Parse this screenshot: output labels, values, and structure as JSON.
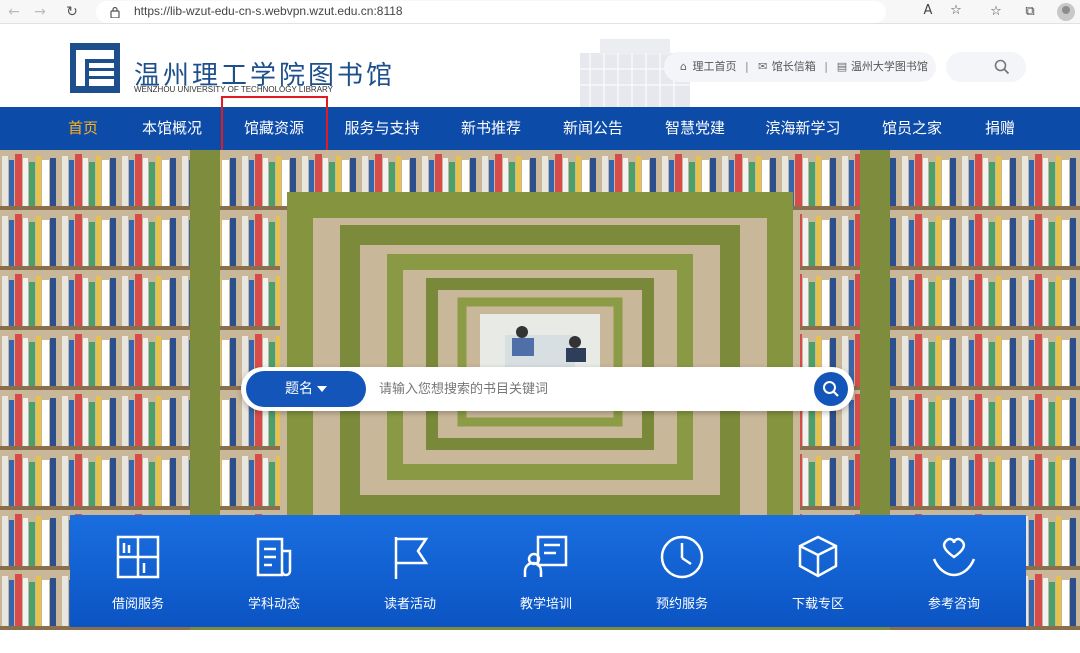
{
  "browser": {
    "url": "https://lib-wzut-edu-cn-s.webvpn.wzut.edu.cn:8118",
    "back_icon": "arrow-left-icon",
    "forward_icon": "arrow-right-icon",
    "reload_icon": "reload-icon"
  },
  "site": {
    "name_cn": "温州理工学院图书馆",
    "name_en": "WENZHOU UNIVERSITY OF TECHNOLOGY LIBRARY",
    "brand_color": "#0d4ba8",
    "active_color": "#ffb21a"
  },
  "quick_links": [
    {
      "label": "理工首页",
      "icon": "home-icon"
    },
    {
      "label": "馆长信箱",
      "icon": "mail-icon"
    },
    {
      "label": "温州大学图书馆",
      "icon": "library-icon"
    }
  ],
  "nav": [
    {
      "label": "首页",
      "active": true
    },
    {
      "label": "本馆概况"
    },
    {
      "label": "馆藏资源",
      "highlighted": true
    },
    {
      "label": "服务与支持"
    },
    {
      "label": "新书推荐"
    },
    {
      "label": "新闻公告"
    },
    {
      "label": "智慧党建"
    },
    {
      "label": "滨海新学习"
    },
    {
      "label": "馆员之家"
    },
    {
      "label": "捐赠"
    }
  ],
  "search": {
    "type_label": "题名",
    "placeholder": "请输入您想搜索的书目关键词"
  },
  "services": [
    {
      "label": "借阅服务",
      "icon": "bookshelf-icon"
    },
    {
      "label": "学科动态",
      "icon": "document-icon"
    },
    {
      "label": "读者活动",
      "icon": "flag-icon"
    },
    {
      "label": "教学培训",
      "icon": "training-icon"
    },
    {
      "label": "预约服务",
      "icon": "clock-icon"
    },
    {
      "label": "下载专区",
      "icon": "download-box-icon"
    },
    {
      "label": "参考咨询",
      "icon": "consult-heart-icon"
    }
  ]
}
